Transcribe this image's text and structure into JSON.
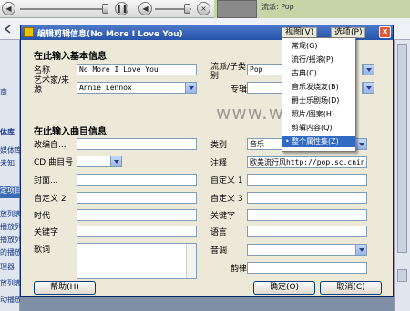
{
  "player": {
    "genre_label": "流派: Pop"
  },
  "library": {
    "left_items": [
      "南",
      "体库",
      "媒体库",
      "未知",
      "定项目",
      "放列表",
      "播放列",
      "播放列",
      "的播放",
      "理器",
      "放列表",
      "动播放列表"
    ]
  },
  "dialog": {
    "title": "编辑剪辑信息(No More I Love You)",
    "menu": {
      "view": "视图(V)",
      "options": "选项(P)"
    },
    "close_glyph": "x",
    "watermark": "www.wave",
    "basic": {
      "section_title": "在此输入基本信息",
      "name_label": "名称",
      "name_value": "No More I Love You",
      "artist_label": "艺术家/来源",
      "artist_value": "Annie Lennox",
      "genre_label": "流派/子类别",
      "genre_value": "Pop",
      "album_label": "专辑",
      "album_value": ""
    },
    "track": {
      "section_title": "在此输入曲目信息",
      "left_labels": [
        "改编自...",
        "CD 曲目号",
        "封面...",
        "自定义 2",
        "时代",
        "关键字",
        "歌词"
      ],
      "right_labels": [
        "类别",
        "注释",
        "自定义 1",
        "自定义 3",
        "关键字",
        "语言",
        "音调",
        "韵律"
      ],
      "category_value": "音乐",
      "comment_value": "欧美流行风http://pop.sc.cnin"
    },
    "buttons": {
      "help": "帮助(H)",
      "ok": "确定(O)",
      "cancel": "取消(C)"
    }
  },
  "view_menu": {
    "items": [
      "常规(G)",
      "流行/摇滚(P)",
      "古典(C)",
      "音乐发烧友(B)",
      "爵士乐剧场(D)",
      "照片/图案(H)",
      "剪辑内容(Q)",
      "整个属性集(Z)"
    ],
    "selected_index": 7
  },
  "colors": {
    "titlebar": "#2553a9",
    "dialog_bg": "#ece9d8",
    "selection": "#316ac5",
    "close_button": "#e05a3a"
  }
}
